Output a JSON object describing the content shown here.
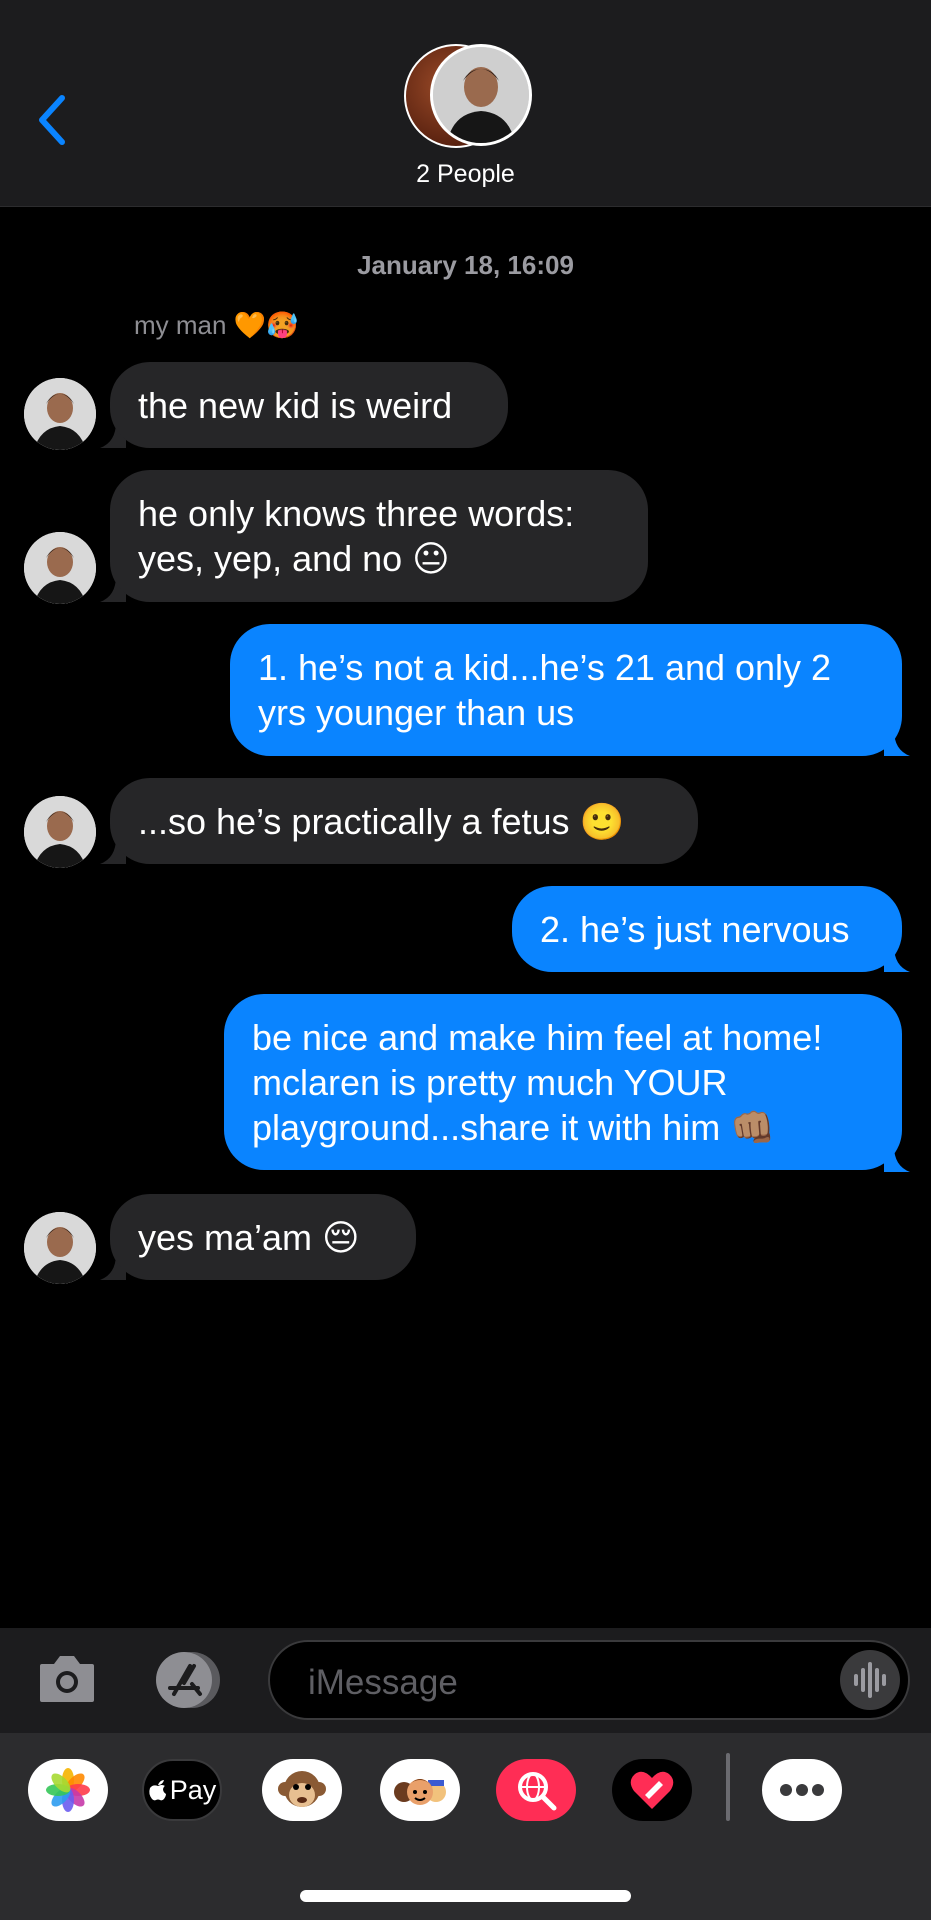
{
  "header": {
    "back_icon": "chevron-left-icon",
    "group_name": "2 People",
    "accent": "#0a84ff"
  },
  "conversation": {
    "timestamp": "January 18, 16:09",
    "sender_name": "my man 🧡🥵",
    "messages": [
      {
        "direction": "incoming",
        "text": "the new kid is weird"
      },
      {
        "direction": "incoming",
        "text": "he only knows three words:\nyes, yep, and no 😐"
      },
      {
        "direction": "outgoing",
        "text": "1. he’s not a kid...he’s 21 and only 2\nyrs younger than us"
      },
      {
        "direction": "incoming",
        "text": "...so he’s practically a fetus 🙂"
      },
      {
        "direction": "outgoing",
        "text": "2. he’s just nervous"
      },
      {
        "direction": "outgoing",
        "text": "be nice and make him feel at home!\nmclaren is pretty much YOUR\nplayground...share it with him 👊🏽"
      },
      {
        "direction": "incoming",
        "text": "yes ma’am 😔"
      }
    ]
  },
  "composer": {
    "placeholder": "iMessage",
    "camera_icon": "camera-icon",
    "apps_icon": "app-store-icon",
    "audio_icon": "waveform-icon"
  },
  "app_tray": {
    "apps": [
      {
        "name": "photos-app-icon"
      },
      {
        "name": "apple-pay-app-icon",
        "label": "Pay"
      },
      {
        "name": "animoji-app-icon"
      },
      {
        "name": "memoji-app-icon"
      },
      {
        "name": "image-search-app-icon"
      },
      {
        "name": "digital-touch-app-icon"
      },
      {
        "name": "more-apps-icon"
      }
    ]
  },
  "colors": {
    "incoming_bubble": "#262628",
    "outgoing_bubble": "#0a84ff",
    "background": "#000000"
  }
}
